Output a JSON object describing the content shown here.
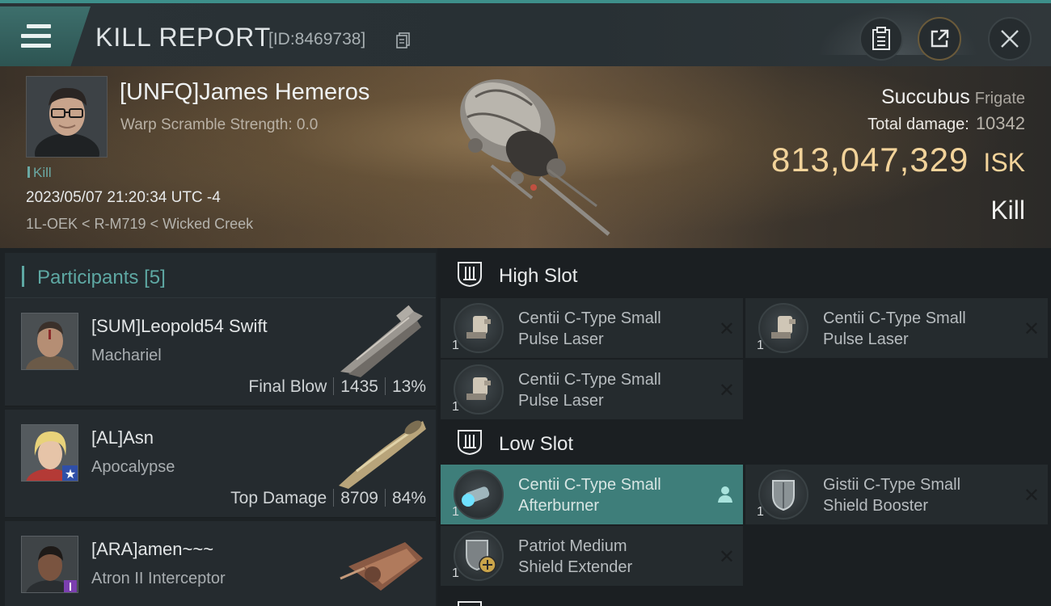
{
  "header": {
    "title": "KILL REPORT",
    "report_id": "[ID:8469738]"
  },
  "victim": {
    "name": "[UNFQ]James Hemeros",
    "warp_scramble": "Warp Scramble Strength: 0.0",
    "tag": "Kill",
    "datetime": "2023/05/07 21:20:34 UTC -4",
    "location": "1L-OEK < R-M719 < Wicked Creek",
    "ship_name": "Succubus",
    "ship_class": "Frigate",
    "total_damage_label": "Total damage:",
    "total_damage": "10342",
    "isk_value": "813,047,329",
    "isk_unit": "ISK",
    "result": "Kill"
  },
  "participants": {
    "label": "Participants",
    "count": "[5]",
    "rows": [
      {
        "name": "[SUM]Leopold54 Swift",
        "ship": "Machariel",
        "role": "Final Blow",
        "damage": "1435",
        "percent": "13%"
      },
      {
        "name": "[AL]Asn",
        "ship": "Apocalypse",
        "role": "Top Damage",
        "damage": "8709",
        "percent": "84%"
      },
      {
        "name": "[ARA]amen~~~",
        "ship": "Atron II Interceptor",
        "role": "",
        "damage": "",
        "percent": ""
      }
    ]
  },
  "fitting": {
    "high_slot_label": "High Slot",
    "low_slot_label": "Low Slot",
    "high": [
      {
        "line1": "Centii C-Type Small",
        "line2": "Pulse Laser",
        "qty": "1"
      },
      {
        "line1": "Centii C-Type Small",
        "line2": "Pulse Laser",
        "qty": "1"
      },
      {
        "line1": "Centii C-Type Small",
        "line2": "Pulse Laser",
        "qty": "1"
      }
    ],
    "low": [
      {
        "line1": "Centii C-Type Small",
        "line2": "Afterburner",
        "qty": "1"
      },
      {
        "line1": "Gistii C-Type Small",
        "line2": "Shield Booster",
        "qty": "1"
      },
      {
        "line1": "Patriot Medium",
        "line2": "Shield Extender",
        "qty": "1"
      }
    ]
  },
  "colors": {
    "accent": "#5ea8a3",
    "isk": "#f2d39a",
    "active_module": "#3e7e7a"
  }
}
